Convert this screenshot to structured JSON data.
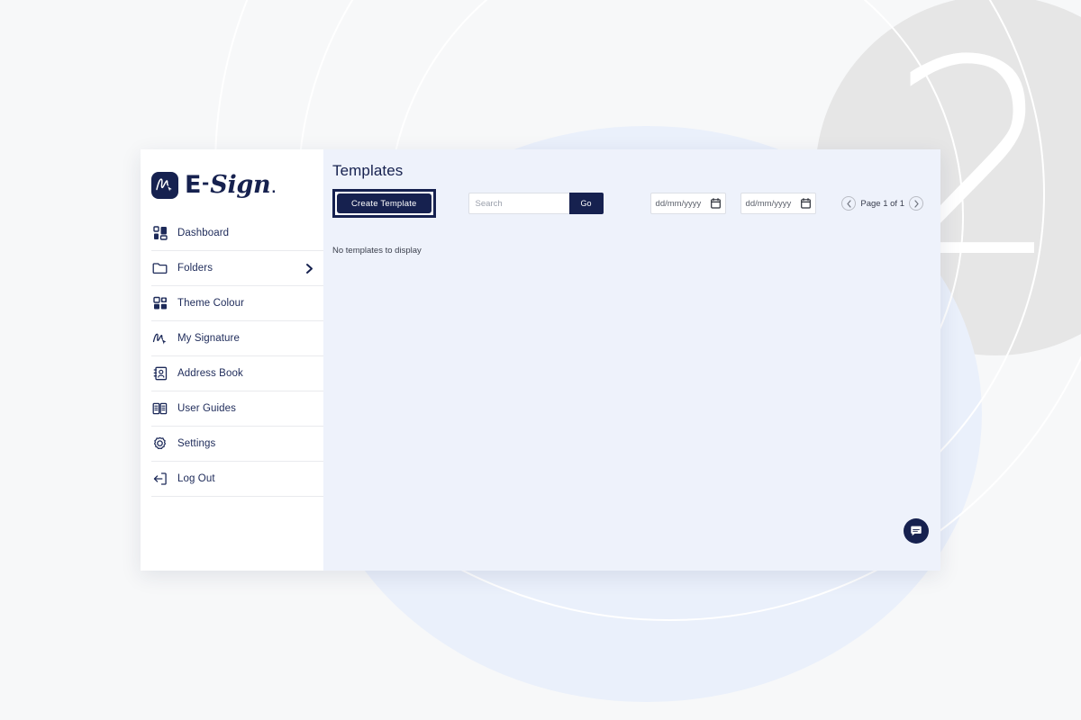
{
  "background": {
    "watermark_number": "2",
    "gray_circle_color": "#e6e6e6",
    "blue_circle_color": "#eaf0fb",
    "ring_color": "#ffffff",
    "page_color": "#f7f8f9"
  },
  "theme": {
    "navy": "#16214f",
    "panel_blue": "#eef2fb",
    "sidebar_white": "#ffffff",
    "divider": "#e9eaee"
  },
  "sidebar": {
    "brand": {
      "name_e": "E",
      "name_dash": "-",
      "name_sign": "Sign",
      "name_dot": ".",
      "mark_icon": "signature-cursor-icon"
    },
    "items": [
      {
        "label": "Dashboard",
        "icon": "dashboard-grid-icon",
        "has_chevron": false
      },
      {
        "label": "Folders",
        "icon": "folder-icon",
        "has_chevron": true
      },
      {
        "label": "Theme Colour",
        "icon": "theme-grid-icon",
        "has_chevron": false
      },
      {
        "label": "My Signature",
        "icon": "signature-icon",
        "has_chevron": false
      },
      {
        "label": "Address Book",
        "icon": "address-book-icon",
        "has_chevron": false
      },
      {
        "label": "User Guides",
        "icon": "open-book-icon",
        "has_chevron": false
      },
      {
        "label": "Settings",
        "icon": "gear-icon",
        "has_chevron": false
      },
      {
        "label": "Log Out",
        "icon": "logout-icon",
        "has_chevron": false
      }
    ]
  },
  "main": {
    "page_title": "Templates",
    "create_template_label": "Create Template",
    "search": {
      "placeholder": "Search",
      "value": "",
      "go_label": "Go"
    },
    "date_from": {
      "display": "dd/mm/yyyy",
      "value": "",
      "icon": "calendar-icon"
    },
    "date_to": {
      "display": "dd/mm/yyyy",
      "value": "",
      "icon": "calendar-icon"
    },
    "pagination": {
      "status": "Page 1 of 1",
      "prev_icon": "chevron-left-icon",
      "next_icon": "chevron-right-icon"
    },
    "empty_state": "No templates to display",
    "chat_button_icon": "chat-bubble-icon"
  }
}
